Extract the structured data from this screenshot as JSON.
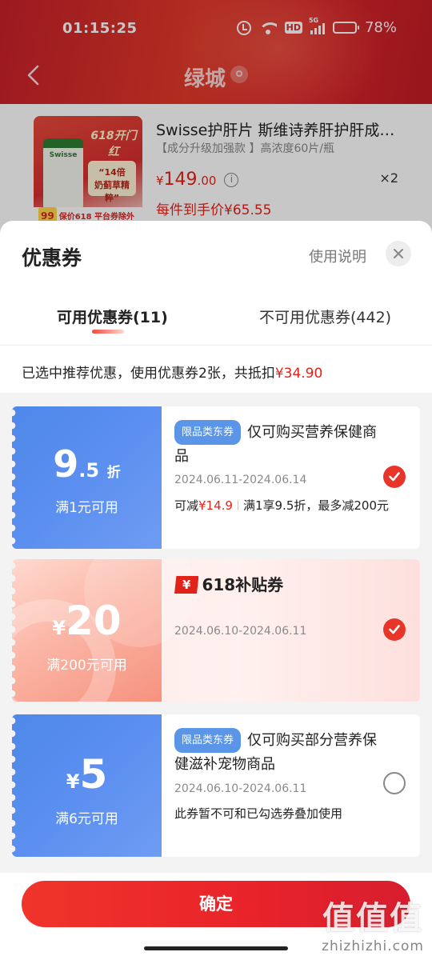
{
  "status_bar": {
    "time": "01:15:25",
    "hd": "HD",
    "network": "5G",
    "battery_text": "78%",
    "battery_level": 0.78
  },
  "nav": {
    "title": "绿城",
    "back_icon": "chevron-left-icon",
    "location_icon": "location-pin-icon"
  },
  "product": {
    "title": "Swisse护肝片 斯维诗养肝护肝成…",
    "spec": "【成分升级加强款 】高浓度60片/瓶",
    "price_symbol": "¥",
    "price_int": "149",
    "price_dec": ".00",
    "quantity": "×2",
    "unit_price": "每件到手价¥65.55",
    "image": {
      "brand": "Swisse",
      "badge": "618开门红",
      "tag_line1": "“14倍",
      "tag_line2": "奶蓟草精粹”",
      "promo_99": "99",
      "promo_text": "保价618 平台券除外"
    }
  },
  "sheet": {
    "title": "优惠券",
    "help": "使用说明",
    "tabs": [
      {
        "label": "可用优惠券(11)"
      },
      {
        "label": "不可用优惠券(442)"
      }
    ],
    "summary_prefix": "已选中推荐优惠，使用优惠券2张，共抵扣",
    "summary_amount": "¥34.90"
  },
  "coupons": [
    {
      "value_main": "9",
      "value_sub": ".5",
      "value_unit": "折",
      "condition": "满1元可用",
      "badge": "限品类东券",
      "title": "仅可购买营养保健商品",
      "date": "2024.06.11-2024.06.14",
      "desc_prefix": "可减",
      "desc_amount": "¥14.9",
      "desc_rest": "满1享9.5折，最多减200元",
      "checked": true
    },
    {
      "symbol": "¥",
      "value_main": "20",
      "condition": "满200元可用",
      "badge": "¥",
      "title": "618补贴券",
      "date": "2024.06.10-2024.06.11",
      "checked": true
    },
    {
      "symbol": "¥",
      "value_main": "5",
      "condition": "满6元可用",
      "badge": "限品类东券",
      "title": "仅可购买部分营养保健滋补宠物商品",
      "date": "2024.06.10-2024.06.11",
      "desc": "此券暂不可和已勾选券叠加使用",
      "checked": false
    }
  ],
  "confirm": {
    "label": "确定"
  },
  "watermark": {
    "big": "值值值",
    "small": "zhizhizhi.com"
  },
  "colors": {
    "accent_red": "#e2231a",
    "coupon_blue": "#5b8ff0",
    "tab_text": "#222222"
  }
}
